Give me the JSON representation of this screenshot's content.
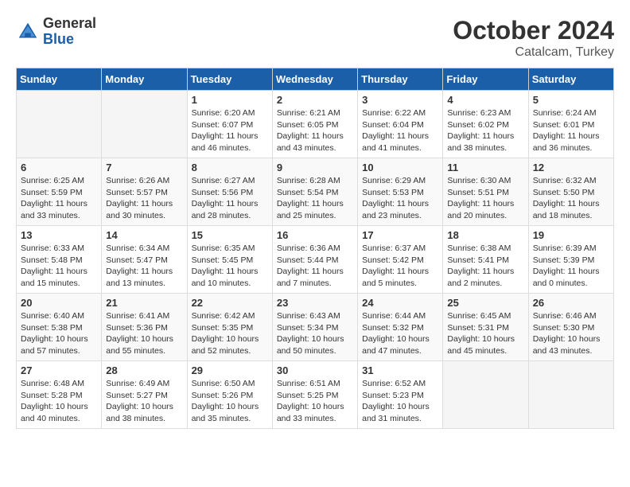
{
  "header": {
    "logo_general": "General",
    "logo_blue": "Blue",
    "month_title": "October 2024",
    "subtitle": "Catalcam, Turkey"
  },
  "calendar": {
    "days_of_week": [
      "Sunday",
      "Monday",
      "Tuesday",
      "Wednesday",
      "Thursday",
      "Friday",
      "Saturday"
    ],
    "weeks": [
      [
        {
          "day": null,
          "info": null
        },
        {
          "day": null,
          "info": null
        },
        {
          "day": "1",
          "sunrise": "Sunrise: 6:20 AM",
          "sunset": "Sunset: 6:07 PM",
          "daylight": "Daylight: 11 hours and 46 minutes."
        },
        {
          "day": "2",
          "sunrise": "Sunrise: 6:21 AM",
          "sunset": "Sunset: 6:05 PM",
          "daylight": "Daylight: 11 hours and 43 minutes."
        },
        {
          "day": "3",
          "sunrise": "Sunrise: 6:22 AM",
          "sunset": "Sunset: 6:04 PM",
          "daylight": "Daylight: 11 hours and 41 minutes."
        },
        {
          "day": "4",
          "sunrise": "Sunrise: 6:23 AM",
          "sunset": "Sunset: 6:02 PM",
          "daylight": "Daylight: 11 hours and 38 minutes."
        },
        {
          "day": "5",
          "sunrise": "Sunrise: 6:24 AM",
          "sunset": "Sunset: 6:01 PM",
          "daylight": "Daylight: 11 hours and 36 minutes."
        }
      ],
      [
        {
          "day": "6",
          "sunrise": "Sunrise: 6:25 AM",
          "sunset": "Sunset: 5:59 PM",
          "daylight": "Daylight: 11 hours and 33 minutes."
        },
        {
          "day": "7",
          "sunrise": "Sunrise: 6:26 AM",
          "sunset": "Sunset: 5:57 PM",
          "daylight": "Daylight: 11 hours and 30 minutes."
        },
        {
          "day": "8",
          "sunrise": "Sunrise: 6:27 AM",
          "sunset": "Sunset: 5:56 PM",
          "daylight": "Daylight: 11 hours and 28 minutes."
        },
        {
          "day": "9",
          "sunrise": "Sunrise: 6:28 AM",
          "sunset": "Sunset: 5:54 PM",
          "daylight": "Daylight: 11 hours and 25 minutes."
        },
        {
          "day": "10",
          "sunrise": "Sunrise: 6:29 AM",
          "sunset": "Sunset: 5:53 PM",
          "daylight": "Daylight: 11 hours and 23 minutes."
        },
        {
          "day": "11",
          "sunrise": "Sunrise: 6:30 AM",
          "sunset": "Sunset: 5:51 PM",
          "daylight": "Daylight: 11 hours and 20 minutes."
        },
        {
          "day": "12",
          "sunrise": "Sunrise: 6:32 AM",
          "sunset": "Sunset: 5:50 PM",
          "daylight": "Daylight: 11 hours and 18 minutes."
        }
      ],
      [
        {
          "day": "13",
          "sunrise": "Sunrise: 6:33 AM",
          "sunset": "Sunset: 5:48 PM",
          "daylight": "Daylight: 11 hours and 15 minutes."
        },
        {
          "day": "14",
          "sunrise": "Sunrise: 6:34 AM",
          "sunset": "Sunset: 5:47 PM",
          "daylight": "Daylight: 11 hours and 13 minutes."
        },
        {
          "day": "15",
          "sunrise": "Sunrise: 6:35 AM",
          "sunset": "Sunset: 5:45 PM",
          "daylight": "Daylight: 11 hours and 10 minutes."
        },
        {
          "day": "16",
          "sunrise": "Sunrise: 6:36 AM",
          "sunset": "Sunset: 5:44 PM",
          "daylight": "Daylight: 11 hours and 7 minutes."
        },
        {
          "day": "17",
          "sunrise": "Sunrise: 6:37 AM",
          "sunset": "Sunset: 5:42 PM",
          "daylight": "Daylight: 11 hours and 5 minutes."
        },
        {
          "day": "18",
          "sunrise": "Sunrise: 6:38 AM",
          "sunset": "Sunset: 5:41 PM",
          "daylight": "Daylight: 11 hours and 2 minutes."
        },
        {
          "day": "19",
          "sunrise": "Sunrise: 6:39 AM",
          "sunset": "Sunset: 5:39 PM",
          "daylight": "Daylight: 11 hours and 0 minutes."
        }
      ],
      [
        {
          "day": "20",
          "sunrise": "Sunrise: 6:40 AM",
          "sunset": "Sunset: 5:38 PM",
          "daylight": "Daylight: 10 hours and 57 minutes."
        },
        {
          "day": "21",
          "sunrise": "Sunrise: 6:41 AM",
          "sunset": "Sunset: 5:36 PM",
          "daylight": "Daylight: 10 hours and 55 minutes."
        },
        {
          "day": "22",
          "sunrise": "Sunrise: 6:42 AM",
          "sunset": "Sunset: 5:35 PM",
          "daylight": "Daylight: 10 hours and 52 minutes."
        },
        {
          "day": "23",
          "sunrise": "Sunrise: 6:43 AM",
          "sunset": "Sunset: 5:34 PM",
          "daylight": "Daylight: 10 hours and 50 minutes."
        },
        {
          "day": "24",
          "sunrise": "Sunrise: 6:44 AM",
          "sunset": "Sunset: 5:32 PM",
          "daylight": "Daylight: 10 hours and 47 minutes."
        },
        {
          "day": "25",
          "sunrise": "Sunrise: 6:45 AM",
          "sunset": "Sunset: 5:31 PM",
          "daylight": "Daylight: 10 hours and 45 minutes."
        },
        {
          "day": "26",
          "sunrise": "Sunrise: 6:46 AM",
          "sunset": "Sunset: 5:30 PM",
          "daylight": "Daylight: 10 hours and 43 minutes."
        }
      ],
      [
        {
          "day": "27",
          "sunrise": "Sunrise: 6:48 AM",
          "sunset": "Sunset: 5:28 PM",
          "daylight": "Daylight: 10 hours and 40 minutes."
        },
        {
          "day": "28",
          "sunrise": "Sunrise: 6:49 AM",
          "sunset": "Sunset: 5:27 PM",
          "daylight": "Daylight: 10 hours and 38 minutes."
        },
        {
          "day": "29",
          "sunrise": "Sunrise: 6:50 AM",
          "sunset": "Sunset: 5:26 PM",
          "daylight": "Daylight: 10 hours and 35 minutes."
        },
        {
          "day": "30",
          "sunrise": "Sunrise: 6:51 AM",
          "sunset": "Sunset: 5:25 PM",
          "daylight": "Daylight: 10 hours and 33 minutes."
        },
        {
          "day": "31",
          "sunrise": "Sunrise: 6:52 AM",
          "sunset": "Sunset: 5:23 PM",
          "daylight": "Daylight: 10 hours and 31 minutes."
        },
        {
          "day": null,
          "info": null
        },
        {
          "day": null,
          "info": null
        }
      ]
    ]
  }
}
